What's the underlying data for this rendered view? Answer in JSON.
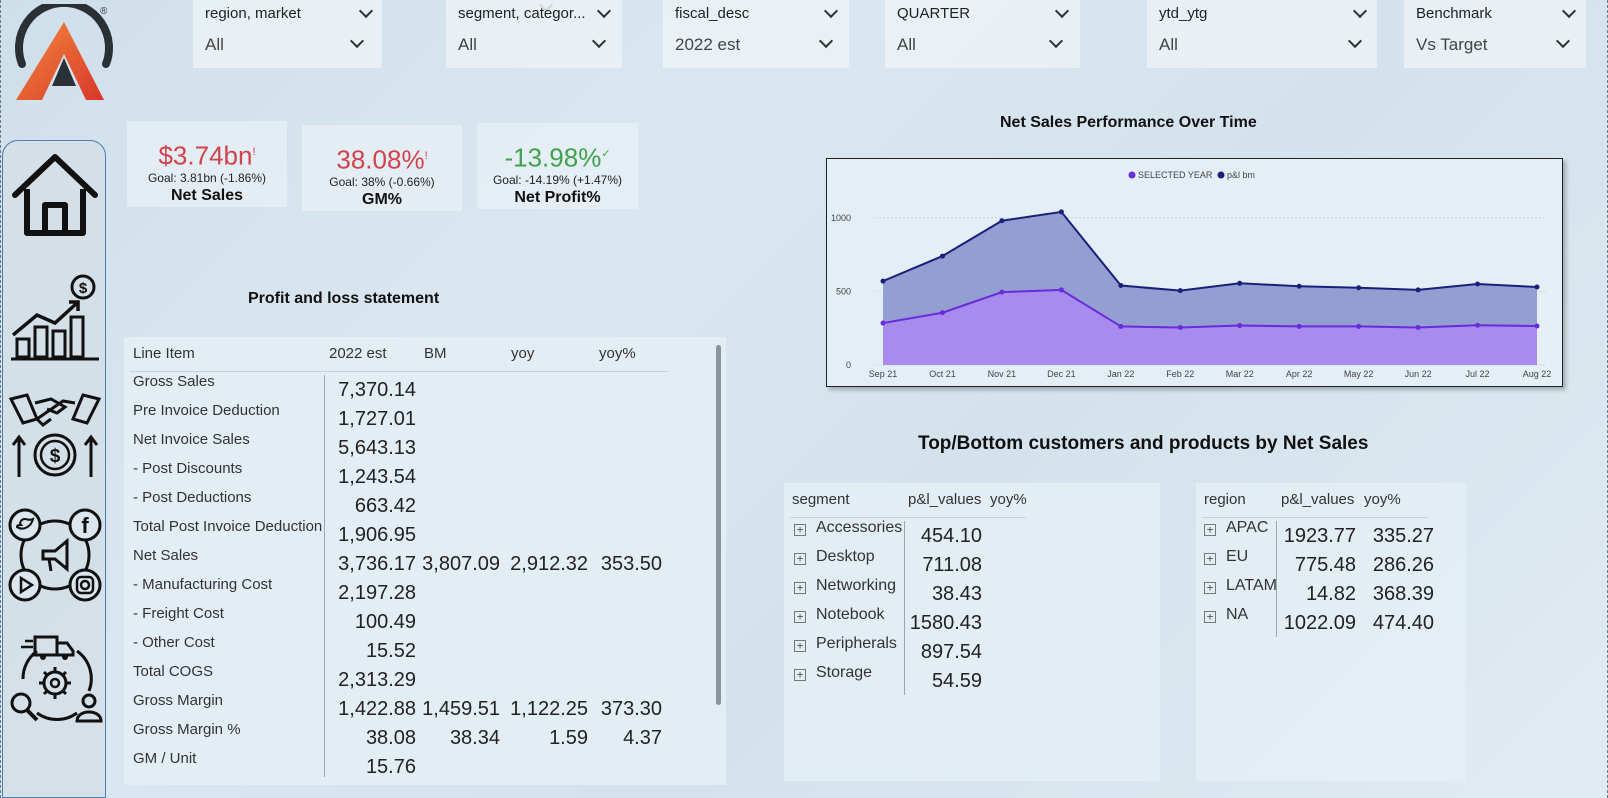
{
  "logo": {
    "registered_mark": "®"
  },
  "slicers": [
    {
      "title": "region, market",
      "value": "All"
    },
    {
      "title": "segment, categor...",
      "value": "All"
    },
    {
      "title": "fiscal_desc",
      "value": "2022 est"
    },
    {
      "title": "QUARTER",
      "value": "All"
    },
    {
      "title": "ytd_ytg",
      "value": "All"
    },
    {
      "title": "Benchmark",
      "value": "Vs Target"
    }
  ],
  "nav": [
    {
      "icon": "home-icon"
    },
    {
      "icon": "finance-growth-icon"
    },
    {
      "icon": "sales-handshake-icon"
    },
    {
      "icon": "marketing-social-icon"
    },
    {
      "icon": "supply-chain-icon"
    }
  ],
  "kpis": [
    {
      "value": "$3.74bn",
      "mark": "!",
      "goal": "Goal: 3.81bn (-1.86%)",
      "label": "Net Sales",
      "status": "bad"
    },
    {
      "value": "38.08%",
      "mark": "!",
      "goal": "Goal: 38% (-0.66%)",
      "label": "GM%",
      "status": "bad"
    },
    {
      "value": "-13.98%",
      "mark": "✓",
      "goal": "Goal: -14.19% (+1.47%)",
      "label": "Net Profit%",
      "status": "good"
    }
  ],
  "pl": {
    "title": "Profit and loss statement",
    "headers": [
      "Line Item",
      "2022 est",
      "BM",
      "yoy",
      "yoy%"
    ],
    "rows": [
      [
        "Gross Sales",
        "7,370.14",
        "",
        "",
        ""
      ],
      [
        "Pre Invoice Deduction",
        "1,727.01",
        "",
        "",
        ""
      ],
      [
        "Net Invoice Sales",
        "5,643.13",
        "",
        "",
        ""
      ],
      [
        "- Post Discounts",
        "1,243.54",
        "",
        "",
        ""
      ],
      [
        "- Post Deductions",
        "663.42",
        "",
        "",
        ""
      ],
      [
        "Total Post Invoice Deduction",
        "1,906.95",
        "",
        "",
        ""
      ],
      [
        "Net Sales",
        "3,736.17",
        "3,807.09",
        "2,912.32",
        "353.50"
      ],
      [
        "- Manufacturing Cost",
        "2,197.28",
        "",
        "",
        ""
      ],
      [
        "- Freight Cost",
        "100.49",
        "",
        "",
        ""
      ],
      [
        "- Other Cost",
        "15.52",
        "",
        "",
        ""
      ],
      [
        "Total COGS",
        "2,313.29",
        "",
        "",
        ""
      ],
      [
        "Gross Margin",
        "1,422.88",
        "1,459.51",
        "1,122.25",
        "373.30"
      ],
      [
        "Gross Margin %",
        "38.08",
        "38.34",
        "1.59",
        "4.37"
      ],
      [
        "GM / Unit",
        "15.76",
        "",
        "",
        ""
      ]
    ]
  },
  "chart": {
    "title": "Net Sales Performance Over Time"
  },
  "chart_data": {
    "type": "area",
    "x": [
      "Sep 21",
      "Oct 21",
      "Nov 21",
      "Dec 21",
      "Jan 22",
      "Feb 22",
      "Mar 22",
      "Apr 22",
      "May 22",
      "Jun 22",
      "Jul 22",
      "Aug 22"
    ],
    "series": [
      {
        "name": "SELECTED YEAR",
        "color": "#6a2bd9",
        "fill": "#a98af0",
        "values": [
          285,
          355,
          495,
          510,
          262,
          255,
          268,
          262,
          262,
          255,
          270,
          265
        ]
      },
      {
        "name": "p&l bm",
        "color": "#1a1f7a",
        "fill": "#8e9ad0",
        "values": [
          570,
          740,
          980,
          1040,
          540,
          505,
          555,
          535,
          525,
          510,
          550,
          530
        ]
      }
    ],
    "yticks": [
      "0",
      "500",
      "1000"
    ],
    "ylim": [
      0,
      1250
    ],
    "legend_position": "top-center",
    "grid": true
  },
  "topbottom": {
    "title": "Top/Bottom customers and products by Net Sales",
    "segment_table": {
      "headers": [
        "segment",
        "p&l_values",
        "yoy%"
      ],
      "rows": [
        [
          "Accessories",
          "454.10",
          ""
        ],
        [
          "Desktop",
          "711.08",
          ""
        ],
        [
          "Networking",
          "38.43",
          ""
        ],
        [
          "Notebook",
          "1580.43",
          ""
        ],
        [
          "Peripherals",
          "897.54",
          ""
        ],
        [
          "Storage",
          "54.59",
          ""
        ]
      ]
    },
    "region_table": {
      "headers": [
        "region",
        "p&l_values",
        "yoy%"
      ],
      "rows": [
        [
          "APAC",
          "1923.77",
          "335.27"
        ],
        [
          "EU",
          "775.48",
          "286.26"
        ],
        [
          "LATAM",
          "14.82",
          "368.39"
        ],
        [
          "NA",
          "1022.09",
          "474.40"
        ]
      ]
    }
  }
}
